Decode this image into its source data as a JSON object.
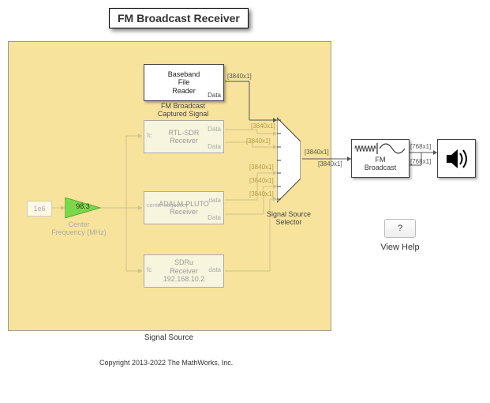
{
  "title": "FM Broadcast Receiver",
  "subsystem_label": "Signal Source",
  "baseband": {
    "line1": "Baseband",
    "line2": "File",
    "line3": "Reader",
    "port": "Data",
    "caption": "FM Broadcast\nCaptured Signal"
  },
  "rtl": {
    "line1": "RTL-SDR",
    "line2": "Receiver",
    "fc": "fc",
    "data": "Data",
    "port2": "Data"
  },
  "pluto": {
    "line1": "ADALM-PLUTO",
    "line2": "Receiver",
    "fc": "center frequency",
    "data": "data",
    "port2": "Data"
  },
  "sdru": {
    "line1": "SDRu",
    "line2": "Receiver",
    "line3": "192.168.10.2",
    "fc": "fc",
    "data": "data"
  },
  "const_1e6": "1e6",
  "freq_gain": "98.3",
  "center_freq_label": "Center\nFrequency (MHz)",
  "selector_label": "Signal Source\nSelector",
  "dim_3840": "[3840x1]",
  "dim_768": "[768x1]",
  "fm_block": "FM\nBroadcast",
  "help_btn": "?",
  "help_label": "View Help",
  "copyright": "Copyright 2013-2022 The MathWorks, Inc."
}
